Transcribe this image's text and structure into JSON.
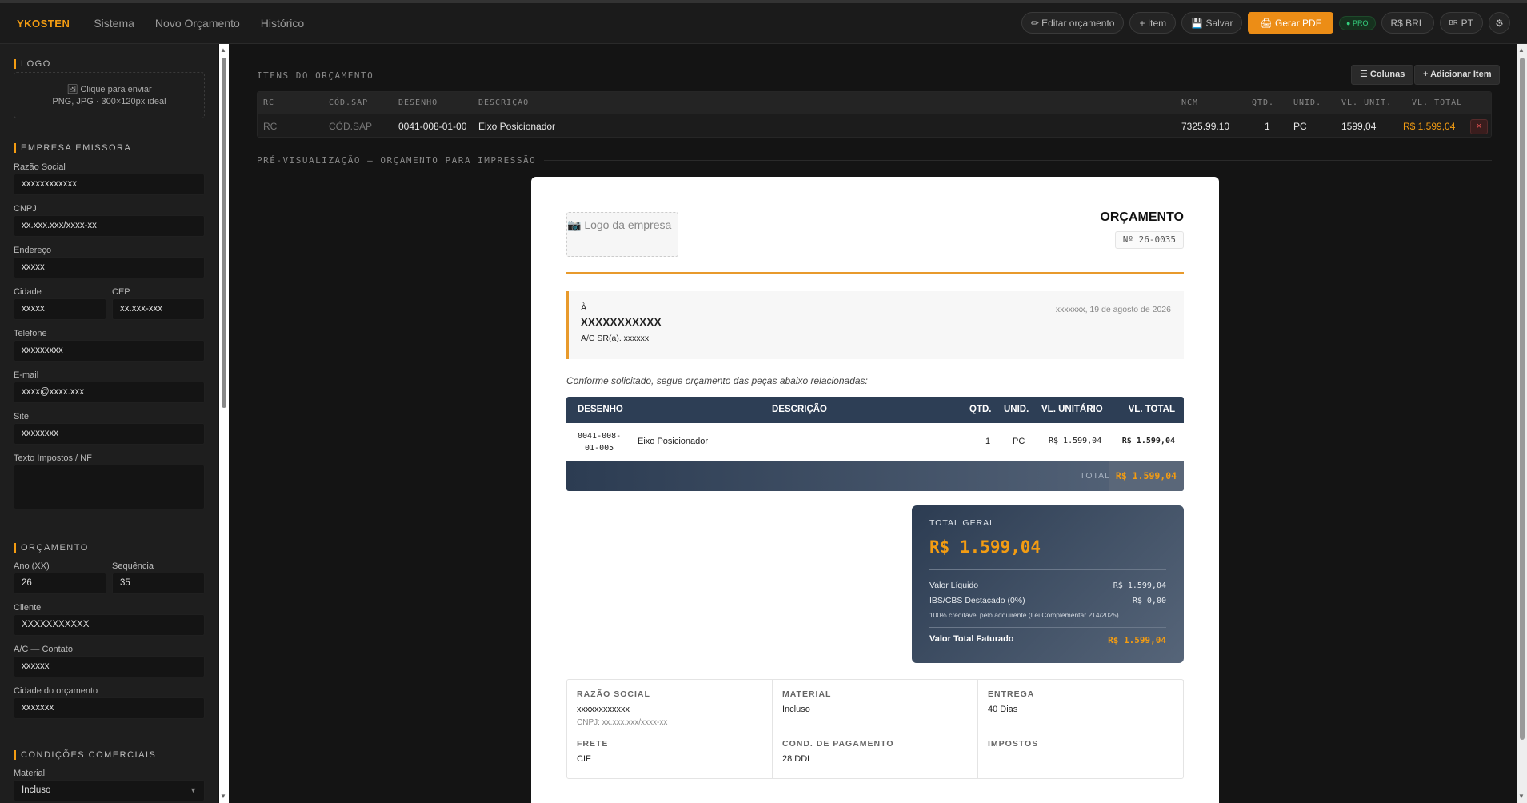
{
  "topbar": {
    "brand": "YKOSTEN",
    "nav": [
      "Sistema",
      "Novo Orçamento",
      "Histórico"
    ],
    "edit_label": "✏ Editar orçamento",
    "item_label": "+ Item",
    "save_label": "💾 Salvar",
    "pdf_label": "🖨 Gerar PDF",
    "pro_label": "● PRO",
    "currency_label": "R$ BRL",
    "lang_label": "PT",
    "lang_flag": "BR",
    "settings_icon": "gear-icon"
  },
  "sidebar": {
    "logo_section": "LOGO",
    "upload_line1": "🖼 Clique para enviar",
    "upload_line2": "PNG, JPG · 300×120px ideal",
    "company_section": "EMPRESA EMISSORA",
    "fields": {
      "razao_label": "Razão Social",
      "razao": "xxxxxxxxxxxx",
      "cnpj_label": "CNPJ",
      "cnpj": "xx.xxx.xxx/xxxx-xx",
      "endereco_label": "Endereço",
      "endereco": "xxxxx",
      "cidade_label": "Cidade",
      "cidade": "xxxxx",
      "cep_label": "CEP",
      "cep": "xx.xxx-xxx",
      "telefone_label": "Telefone",
      "telefone": "xxxxxxxxx",
      "email_label": "E-mail",
      "email": "xxxx@xxxx.xxx",
      "site_label": "Site",
      "site": "xxxxxxxx",
      "impostos_label": "Texto Impostos / NF",
      "impostos": ""
    },
    "budget_section": "ORÇAMENTO",
    "budget": {
      "ano_label": "Ano (XX)",
      "ano": "26",
      "seq_label": "Sequência",
      "seq": "35",
      "cliente_label": "Cliente",
      "cliente": "XXXXXXXXXXX",
      "contato_label": "A/C — Contato",
      "contato": "xxxxxx",
      "cidade_label": "Cidade do orçamento",
      "cidade": "xxxxxxx"
    },
    "commercial_section": "CONDIÇÕES COMERCIAIS",
    "material_label": "Material",
    "material_value": "Incluso"
  },
  "items": {
    "title": "ITENS DO ORÇAMENTO",
    "columns_btn": "☰ Colunas",
    "add_btn": "+ Adicionar Item",
    "headers": [
      "RC",
      "CÓD.SAP",
      "DESENHO",
      "DESCRIÇÃO",
      "NCM",
      "QTD.",
      "UNID.",
      "VL. UNIT.",
      "VL. TOTAL"
    ],
    "row": {
      "rc": "RC",
      "sap": "CÓD.SAP",
      "desenho": "0041-008-01-00",
      "descricao": "Eixo Posicionador",
      "ncm": "7325.99.10",
      "qtd": "1",
      "unid": "PC",
      "vl_unit": "1599,04",
      "vl_total": "R$ 1.599,04"
    },
    "delete": "×"
  },
  "preview": {
    "title": "PRÉ-VISUALIZAÇÃO — ORÇAMENTO PARA IMPRESSÃO",
    "logo_placeholder": "📷 Logo da empresa",
    "doc_title": "ORÇAMENTO",
    "doc_number": "Nº 26-0035",
    "to_label": "À",
    "client": "XXXXXXXXXXX",
    "contact": "A/C SR(a). xxxxxx",
    "date": "xxxxxxx, 19 de agosto de 2026",
    "intro": "Conforme solicitado, segue orçamento das peças abaixo relacionadas:",
    "table_headers": {
      "desenho": "DESENHO",
      "descricao": "DESCRIÇÃO",
      "qtd": "QTD.",
      "unid": "UNID.",
      "vl_unit": "VL. UNITÁRIO",
      "vl_total": "VL. TOTAL"
    },
    "row": {
      "desenho_1": "0041-008-",
      "desenho_2": "01-005",
      "descricao": "Eixo Posicionador",
      "qtd": "1",
      "unid": "PC",
      "vl_unit": "R$ 1.599,04",
      "vl_total": "R$ 1.599,04"
    },
    "total_label": "TOTAL",
    "total_value": "R$ 1.599,04",
    "card": {
      "label": "TOTAL GERAL",
      "value": "R$ 1.599,04",
      "liquido_label": "Valor Líquido",
      "liquido": "R$ 1.599,04",
      "ibs_label": "IBS/CBS Destacado (0%)",
      "ibs": "R$ 0,00",
      "note": "100% creditável pelo adquirente (Lei Complementar 214/2025)",
      "faturado_label": "Valor Total Faturado",
      "faturado": "R$ 1.599,04"
    },
    "conditions": {
      "razao_k": "RAZÃO SOCIAL",
      "razao_v": "xxxxxxxxxxxx",
      "razao_s": "CNPJ: xx.xxx.xxx/xxxx-xx",
      "material_k": "MATERIAL",
      "material_v": "Incluso",
      "entrega_k": "ENTREGA",
      "entrega_v": "40 Dias",
      "frete_k": "FRETE",
      "frete_v": "CIF",
      "pagamento_k": "COND. DE PAGAMENTO",
      "pagamento_v": "28 DDL",
      "impostos_k": "IMPOSTOS",
      "impostos_v": ""
    }
  },
  "colors": {
    "accent": "#f39c12",
    "navy": "#2d3e55",
    "pro_green": "#35d07f"
  }
}
